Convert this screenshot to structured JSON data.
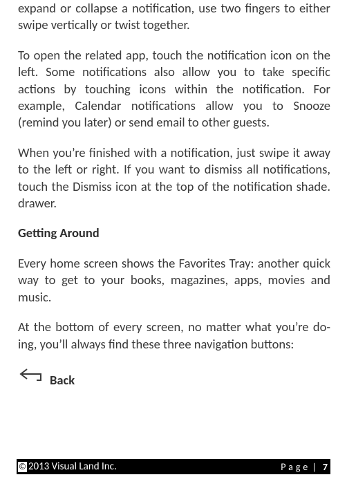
{
  "body": {
    "p1": "expand or collapse a notification, use two fingers to either swipe vertically or twist together.",
    "p2": "To open the related app, touch the notification icon on the left. Some notifications also allow you to take specific actions by touching icons within the notification. For example, Calendar notifications allow you to Snooze (remind you later) or send email to other guests.",
    "p3": "When you’re finished with a notification, just swipe it away to the left or right. If you want to dismiss all notifications, touch the Dismiss icon at the top of the notification shade. drawer.",
    "h1": "Getting Around",
    "p4": "Every home screen shows the Favorites Tray: another quick way to get to your books, magazines, apps, movies and music.",
    "p5": "At the bottom of every screen, no matter what you’re do-ing, you’ll always find these three navigation buttons:",
    "back_label": "Back"
  },
  "footer": {
    "copyright_symbol": "©",
    "copyright_text": "2013 Visual Land Inc.",
    "page_word": "Page",
    "page_sep": "|",
    "page_num": "7"
  }
}
